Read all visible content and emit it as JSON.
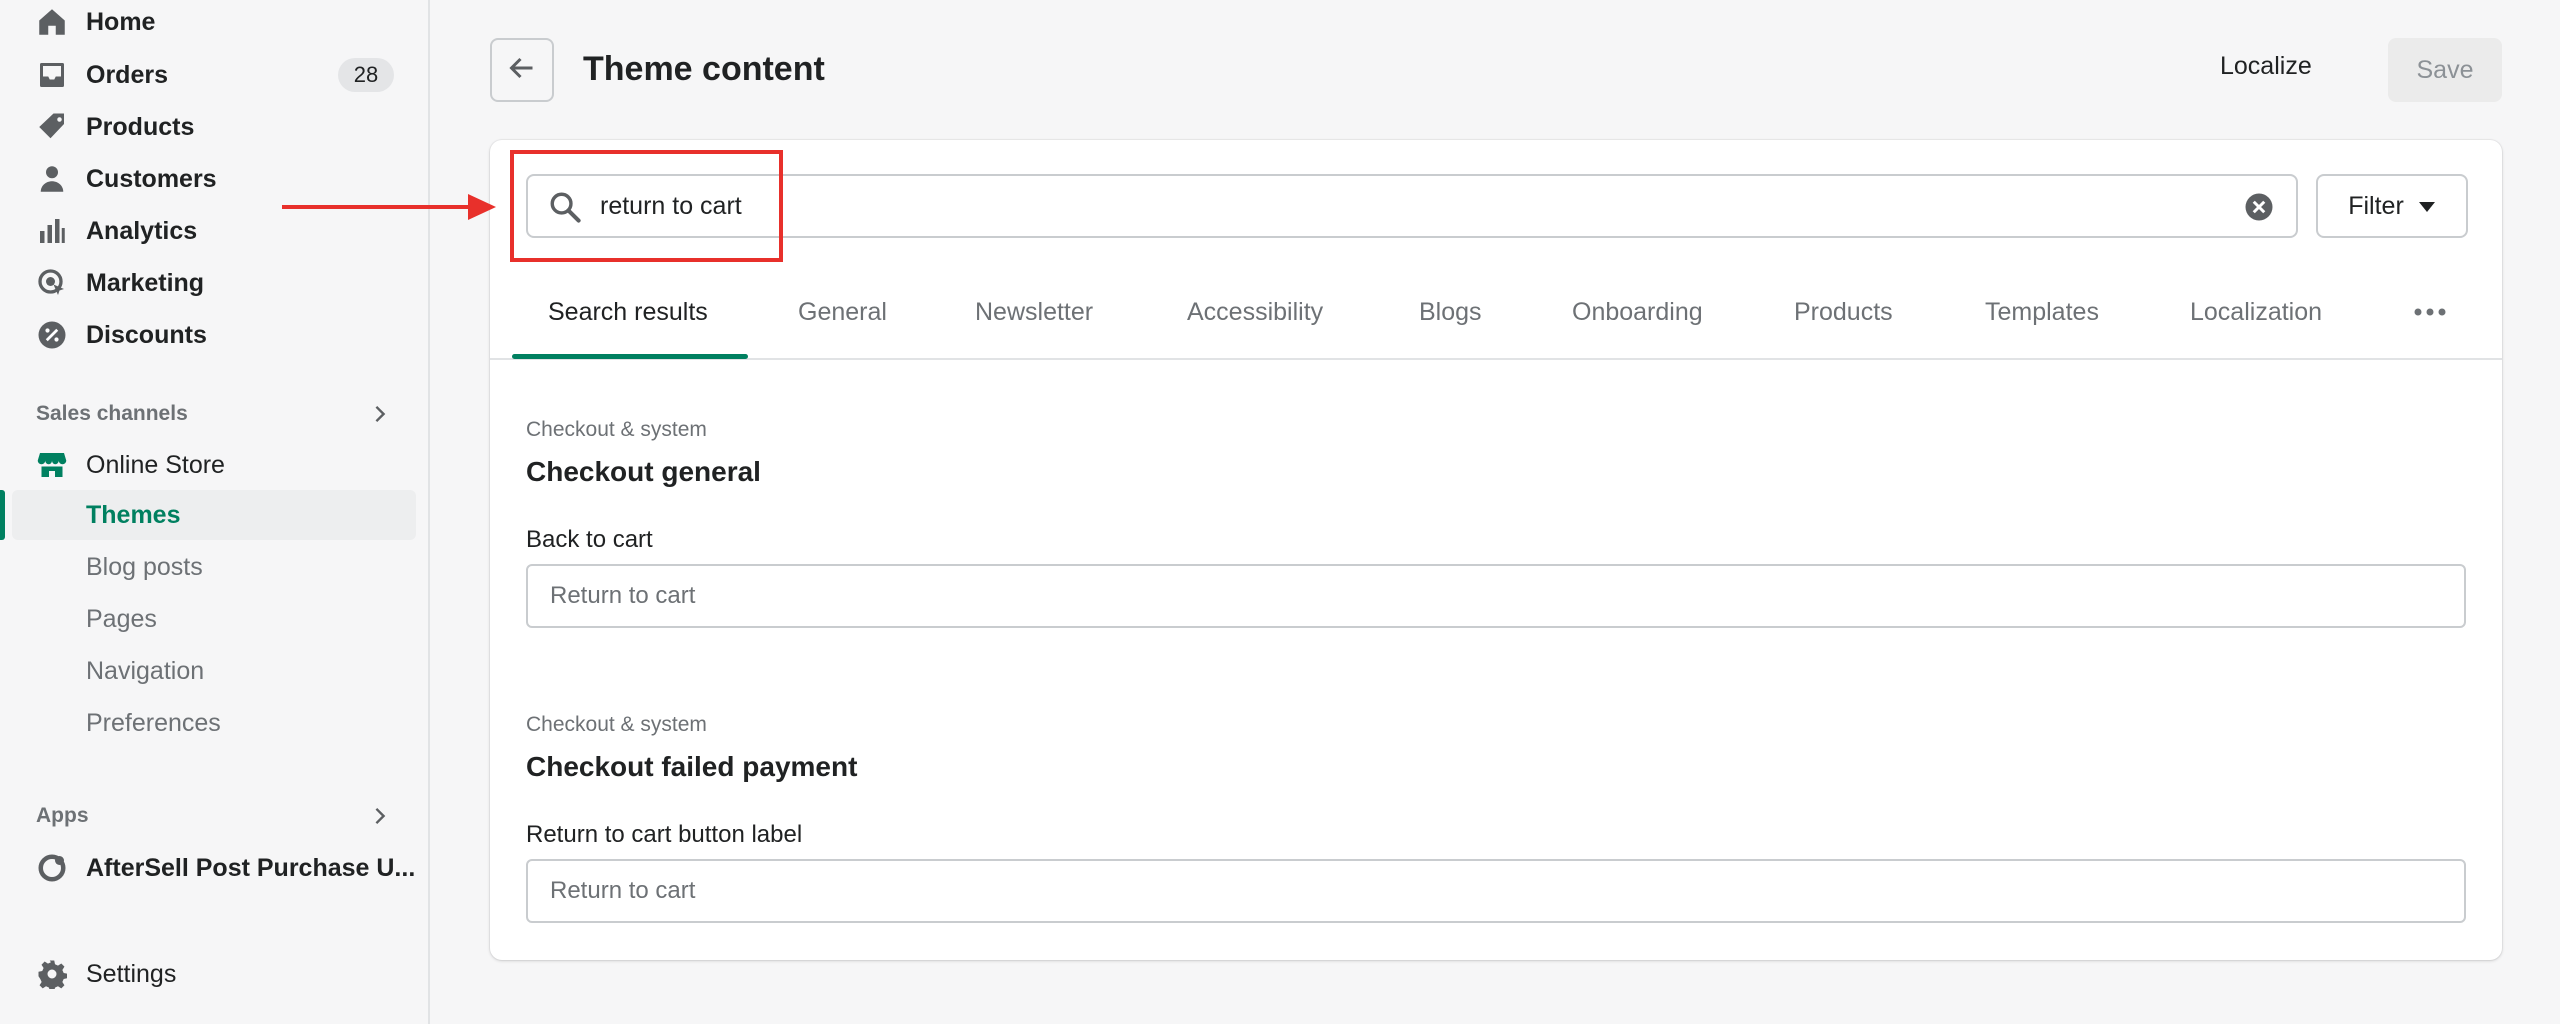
{
  "sidebar": {
    "items": [
      {
        "label": "Home",
        "icon": "home-icon"
      },
      {
        "label": "Orders",
        "icon": "orders-icon",
        "badge": "28"
      },
      {
        "label": "Products",
        "icon": "tag-icon"
      },
      {
        "label": "Customers",
        "icon": "person-icon"
      },
      {
        "label": "Analytics",
        "icon": "bar-chart-icon"
      },
      {
        "label": "Marketing",
        "icon": "marketing-icon"
      },
      {
        "label": "Discounts",
        "icon": "discount-icon"
      }
    ],
    "sales_channels_header": "Sales channels",
    "online_store": {
      "label": "Online Store",
      "icon": "store-icon",
      "subitems": [
        {
          "label": "Themes",
          "active": true
        },
        {
          "label": "Blog posts"
        },
        {
          "label": "Pages"
        },
        {
          "label": "Navigation"
        },
        {
          "label": "Preferences"
        }
      ]
    },
    "apps_header": "Apps",
    "app_item": {
      "label": "AfterSell Post Purchase U...",
      "icon": "app-icon"
    },
    "settings": {
      "label": "Settings",
      "icon": "gear-icon"
    }
  },
  "header": {
    "title": "Theme content",
    "localize_label": "Localize",
    "save_label": "Save"
  },
  "search": {
    "value": "return to cart",
    "filter_label": "Filter"
  },
  "tabs": [
    {
      "label": "Search results",
      "active": true
    },
    {
      "label": "General"
    },
    {
      "label": "Newsletter"
    },
    {
      "label": "Accessibility"
    },
    {
      "label": "Blogs"
    },
    {
      "label": "Onboarding"
    },
    {
      "label": "Products"
    },
    {
      "label": "Templates"
    },
    {
      "label": "Localization"
    }
  ],
  "results": [
    {
      "caption": "Checkout & system",
      "title": "Checkout general",
      "field_label": "Back to cart",
      "field_value": "Return to cart"
    },
    {
      "caption": "Checkout & system",
      "title": "Checkout failed payment",
      "field_label": "Return to cart button label",
      "field_value": "Return to cart"
    }
  ],
  "colors": {
    "accent": "#008060",
    "annotation": "#e8302b",
    "background": "#f6f6f7"
  }
}
